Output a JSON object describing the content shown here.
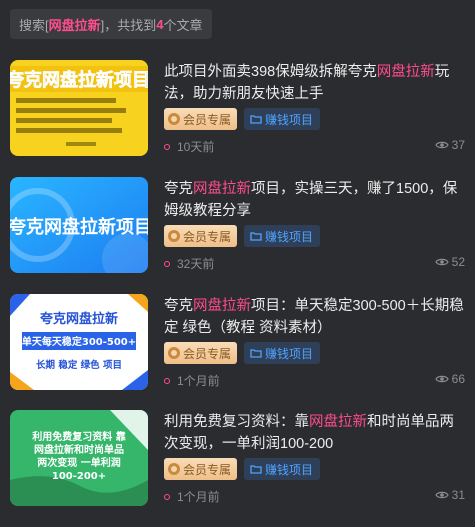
{
  "search": {
    "prefix": "搜索[",
    "keyword": "网盘拉新",
    "middle": "]，共找到",
    "count": "4",
    "suffix": "个文章"
  },
  "tags": {
    "vip": "会员专属",
    "category": "赚钱项目"
  },
  "posts": [
    {
      "title_before": "此项目外面卖398保姆级拆解夸克",
      "title_highlight": "网盘拉新",
      "title_after": "玩法，助力新朋友快速上手",
      "time": "10天前",
      "views": "37",
      "thumb_text": "夸克网盘拉新项目",
      "thumb_sub": "1.保姆级教程 2.新手可操作 3.稳定收益 4.全套资料"
    },
    {
      "title_before": "夸克",
      "title_highlight": "网盘拉新",
      "title_after": "项目，实操三天，赚了1500，保姆级教程分享",
      "time": "32天前",
      "views": "52",
      "thumb_text": "夸克网盘拉新项目"
    },
    {
      "title_before": "夸克",
      "title_highlight": "网盘拉新",
      "title_after": "项目：单天稳定300-500＋长期稳定 绿色（教程 资料素材）",
      "time": "1个月前",
      "views": "66",
      "thumb_line1": "夸克网盘拉新",
      "thumb_line2": "单天每天稳定300-500+",
      "thumb_line3": "长期 稳定 绿色 项目"
    },
    {
      "title_before": "利用免费复习资料：靠",
      "title_highlight": "网盘拉新",
      "title_after": "和时尚单品两次变现，一单利润100-200",
      "time": "1个月前",
      "views": "31",
      "thumb_line1": "利用免费复习资料 靠",
      "thumb_line2": "网盘拉新和时尚单品",
      "thumb_line3": "两次变现 一单利润",
      "thumb_line4": "100-200+"
    }
  ]
}
